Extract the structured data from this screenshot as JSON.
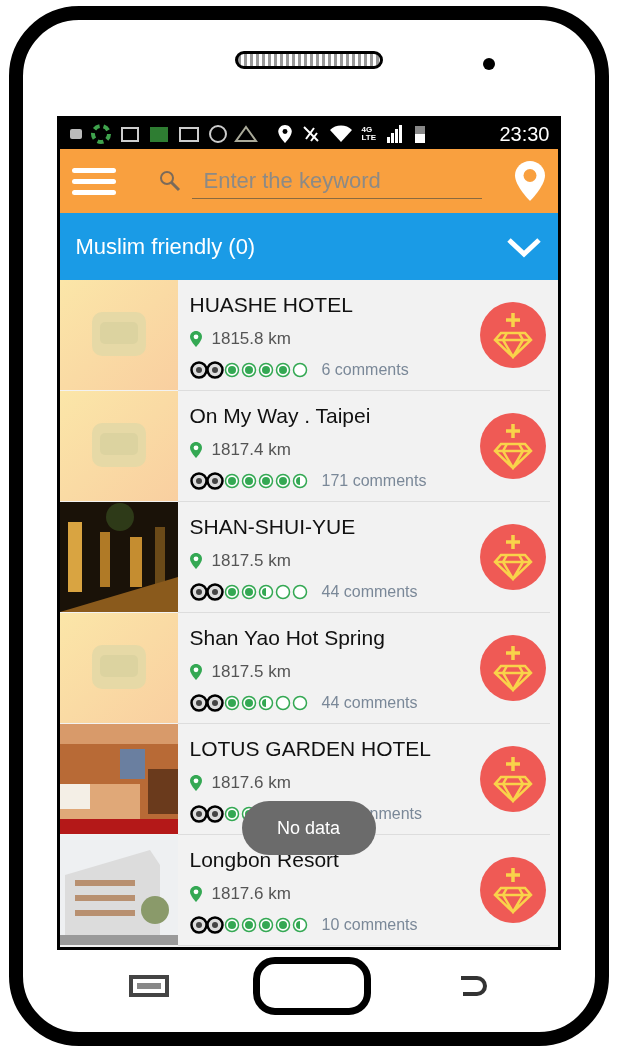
{
  "status_bar": {
    "network": [
      "4G",
      "LTE"
    ],
    "time": "23:30"
  },
  "toolbar": {
    "search": {
      "placeholder": "Enter the keyword"
    }
  },
  "filter": {
    "label": "Muslim friendly (0)",
    "expanded": false
  },
  "hotels": [
    {
      "name": "HUASHE HOTEL",
      "distance": "1815.8 km",
      "stars": 4,
      "comments": "6 comments"
    },
    {
      "name": "On My Way . Taipei",
      "distance": "1817.4 km",
      "stars": 4.5,
      "comments": "171 comments"
    },
    {
      "name": "SHAN-SHUI-YUE",
      "distance": "1817.5 km",
      "stars": 2.5,
      "comments": "44 comments"
    },
    {
      "name": "Shan Yao Hot Spring",
      "distance": "1817.5 km",
      "stars": 2.5,
      "comments": "44 comments"
    },
    {
      "name": "LOTUS GARDEN HOTEL",
      "distance": "1817.6 km",
      "comments": "nments",
      "covered": true
    },
    {
      "name": "Longbon Resort",
      "distance": "1817.6 km",
      "stars": 4.5,
      "comments": "10 comments"
    }
  ],
  "toast": "No data"
}
